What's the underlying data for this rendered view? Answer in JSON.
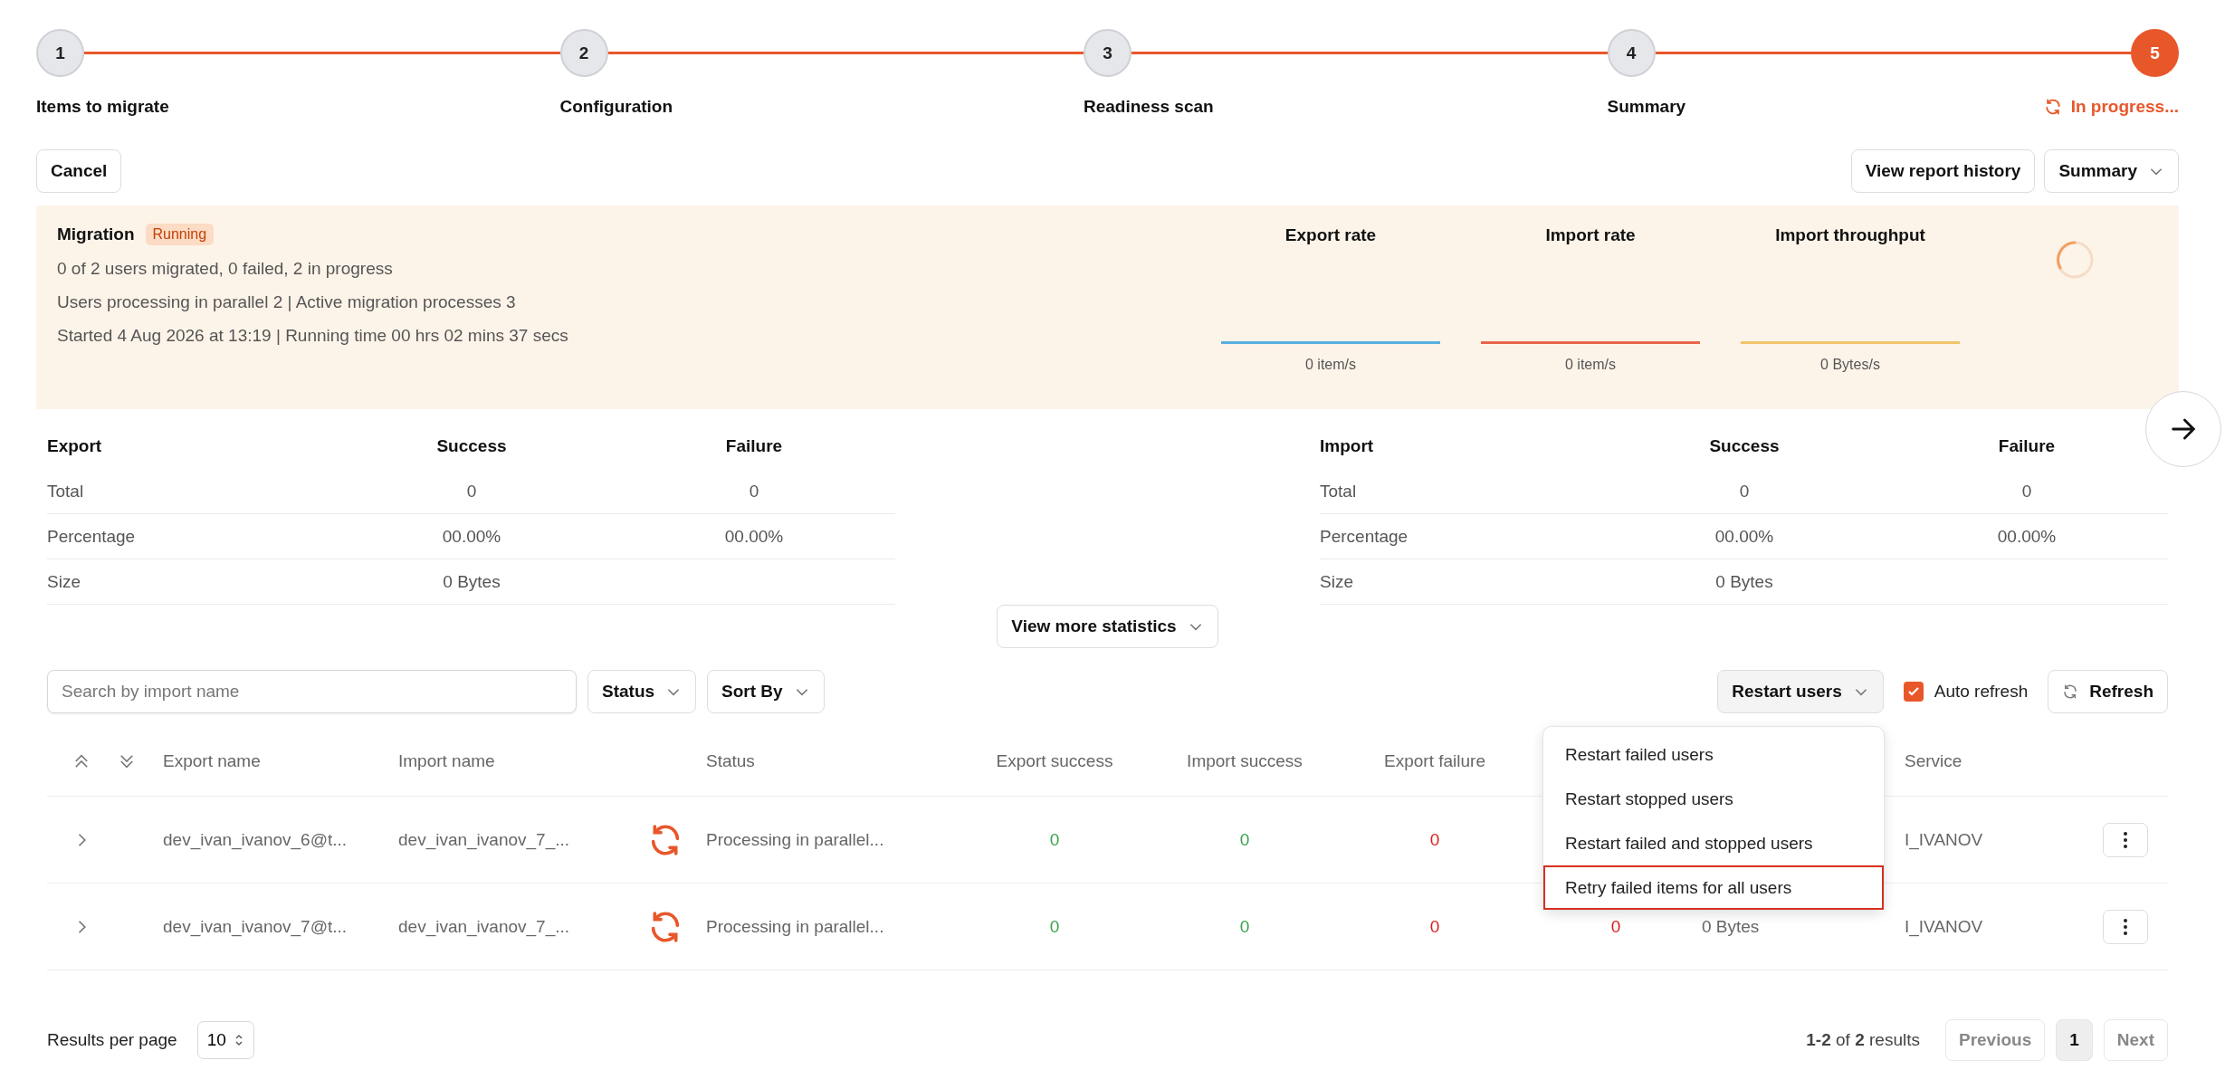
{
  "stepper": {
    "steps": [
      {
        "number": "1",
        "label": "Items to migrate",
        "active": false
      },
      {
        "number": "2",
        "label": "Configuration",
        "active": false
      },
      {
        "number": "3",
        "label": "Readiness scan",
        "active": false
      },
      {
        "number": "4",
        "label": "Summary",
        "active": false
      },
      {
        "number": "5",
        "label": "In progress...",
        "active": true
      }
    ]
  },
  "actions": {
    "cancel": "Cancel",
    "history": "View report history",
    "summary": "Summary"
  },
  "migration": {
    "title": "Migration",
    "badge": "Running",
    "lines": [
      "0 of 2 users migrated, 0 failed, 2 in progress",
      "Users processing in parallel 2 | Active migration processes 3",
      "Started 4 Aug 2026 at 13:19 | Running time 00 hrs 02 mins 37 secs"
    ],
    "rates": [
      {
        "title": "Export rate",
        "value": "0 item/s",
        "color": "#5aaee0"
      },
      {
        "title": "Import rate",
        "value": "0 item/s",
        "color": "#e8654a"
      },
      {
        "title": "Import throughput",
        "value": "0 Bytes/s",
        "color": "#f2c46a"
      }
    ]
  },
  "stats": [
    {
      "columns": [
        "Export",
        "Success",
        "Failure"
      ],
      "rows": [
        [
          "Total",
          "0",
          "0"
        ],
        [
          "Percentage",
          "00.00%",
          "00.00%"
        ],
        [
          "Size",
          "0 Bytes"
        ]
      ]
    },
    {
      "columns": [
        "Import",
        "Success",
        "Failure"
      ],
      "rows": [
        [
          "Total",
          "0",
          "0"
        ],
        [
          "Percentage",
          "00.00%",
          "00.00%"
        ],
        [
          "Size",
          "0 Bytes"
        ]
      ]
    }
  ],
  "view_more": "View more statistics",
  "toolbar": {
    "search": {
      "placeholder": "Search by import name"
    },
    "filters": [
      "Status",
      "Sort By"
    ],
    "restart": "Restart users",
    "auto_refresh": {
      "label": "Auto refresh",
      "checked": true
    },
    "refresh": "Refresh"
  },
  "table": {
    "columns": [
      "Export name",
      "Import name",
      "Status",
      "Export success",
      "Import success",
      "Export failure",
      "Service"
    ],
    "rows": [
      {
        "export_name": "dev_ivan_ivanov_6@t...",
        "import_name": "dev_ivan_ivanov_7_...",
        "status": "Processing in parallel...",
        "export_success": "0",
        "import_success": "0",
        "export_failure": "0",
        "service": "I_IVANOV"
      },
      {
        "export_name": "dev_ivan_ivanov_7@t...",
        "import_name": "dev_ivan_ivanov_7_...",
        "status": "Processing in parallel...",
        "export_success": "0",
        "import_success": "0",
        "export_failure": "0",
        "import_failure": "0",
        "size": "0 Bytes",
        "service": "I_IVANOV"
      }
    ]
  },
  "restart_menu": {
    "items": [
      {
        "label": "Restart failed users",
        "selected": false
      },
      {
        "label": "Restart stopped users",
        "selected": false
      },
      {
        "label": "Restart failed and stopped users",
        "selected": false
      },
      {
        "label": "Retry failed items for all users",
        "selected": true
      }
    ]
  },
  "footer": {
    "per_page_label": "Results per page",
    "per_page": "10",
    "range": "**1-2** of **2** results",
    "previous": "Previous",
    "pages": [
      {
        "label": "1",
        "selected": true
      }
    ],
    "next": "Next"
  }
}
